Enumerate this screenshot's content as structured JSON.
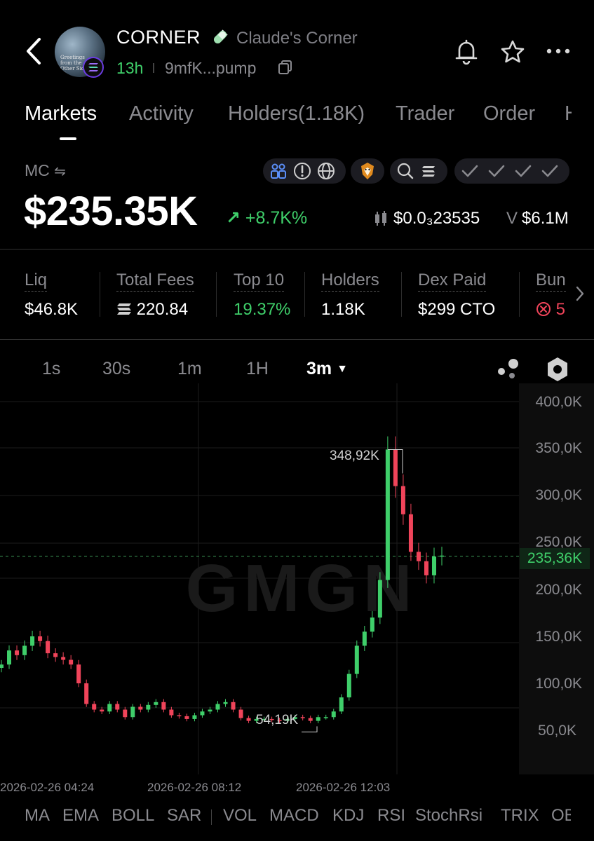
{
  "header": {
    "token_name": "CORNER",
    "token_subtitle": "Claude's Corner",
    "age": "13h",
    "address": "9mfK...pump",
    "avatar_text": "Greetings from the Other Side of..."
  },
  "tabs": [
    {
      "label": "Markets",
      "active": true
    },
    {
      "label": "Activity"
    },
    {
      "label": "Holders(1.18K)"
    },
    {
      "label": "Trader"
    },
    {
      "label": "Order"
    },
    {
      "label": "H"
    }
  ],
  "market": {
    "mc_label": "MC",
    "mc_value": "$235.35K",
    "mc_change": "+8.7K%",
    "price": "$0.0₃23535",
    "volume_prefix": "V",
    "volume": "$6.1M"
  },
  "stats": [
    {
      "label": "Liq",
      "value": "$46.8K"
    },
    {
      "label": "Total Fees",
      "value": "220.84"
    },
    {
      "label": "Top 10",
      "value": "19.37%"
    },
    {
      "label": "Holders",
      "value": "1.18K"
    },
    {
      "label": "Dex Paid",
      "value": "$299 CTO"
    },
    {
      "label": "Bun",
      "value": "5"
    }
  ],
  "timeframes": [
    {
      "label": "1s"
    },
    {
      "label": "30s"
    },
    {
      "label": "1m"
    },
    {
      "label": "1H"
    },
    {
      "label": "3m",
      "active": true
    }
  ],
  "chart": {
    "watermark": "GMGN",
    "current_price_label": "235,36K",
    "high_label": "348,92K",
    "low_label": "54,19K",
    "y_ticks": [
      "400,0K",
      "350,0K",
      "300,0K",
      "250,0K",
      "200,0K",
      "150,0K",
      "100,0K",
      "50,0K"
    ],
    "x_ticks": [
      "2026-02-26 04:24",
      "2026-02-26 08:12",
      "2026-02-26 12:03"
    ]
  },
  "chart_data": {
    "type": "line",
    "ylim": [
      20000,
      420000
    ],
    "current": 235360,
    "high": 348920,
    "low": 54190,
    "x": [
      "2026-02-26 04:24",
      "2026-02-26 08:12",
      "2026-02-26 12:03"
    ],
    "series": [
      {
        "values": [
          120000,
          135000,
          130000,
          140000,
          150000,
          145000,
          132000,
          128000,
          125000,
          120000,
          100000,
          78000,
          72000,
          70000,
          78000,
          72000,
          64000,
          75000,
          72000,
          77000,
          80000,
          72000,
          66000,
          65000,
          62000,
          66000,
          70000,
          72000,
          78000,
          80000,
          72000,
          63000,
          60000,
          62000,
          62000,
          61000,
          60000,
          62000,
          64000,
          63000,
          60000,
          64000,
          64000,
          70000,
          85000,
          110000,
          140000,
          155000,
          170000,
          210000,
          349000,
          310000,
          280000,
          240000,
          230000,
          215000,
          235000,
          236000
        ]
      }
    ]
  },
  "indicators": [
    "MA",
    "EMA",
    "BOLL",
    "SAR",
    "VOL",
    "MACD",
    "KDJ",
    "RSI",
    "StochRsi",
    "TRIX",
    "OB"
  ],
  "colors": {
    "up": "#3fcf6a",
    "down": "#f0445a",
    "accent_blue": "#5b8ff9"
  }
}
